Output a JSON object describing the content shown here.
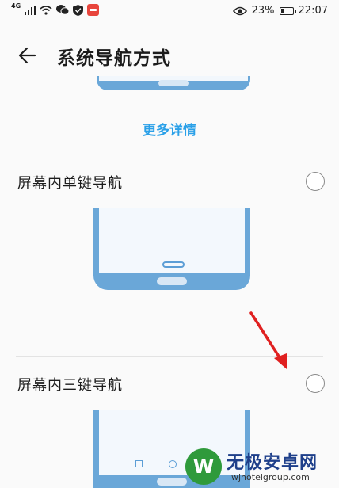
{
  "status": {
    "network": "4G",
    "battery_percent": "23%",
    "battery_level": 0.23,
    "time": "22:07",
    "icons": [
      "signal-icon",
      "wifi-icon",
      "wechat-icon",
      "shield-icon",
      "app-icon",
      "eye-icon"
    ]
  },
  "header": {
    "back_icon": "back-arrow-icon",
    "title": "系统导航方式"
  },
  "more_details": "更多详情",
  "options": [
    {
      "label": "屏幕内单键导航",
      "selected": false
    },
    {
      "label": "屏幕内三键导航",
      "selected": false
    }
  ],
  "watermark": {
    "name": "无极安卓网",
    "url": "wjhotelgroup.com"
  },
  "colors": {
    "accent": "#2aa0e8",
    "phone_frame": "#6aa7d8",
    "arrow": "#e02020"
  }
}
